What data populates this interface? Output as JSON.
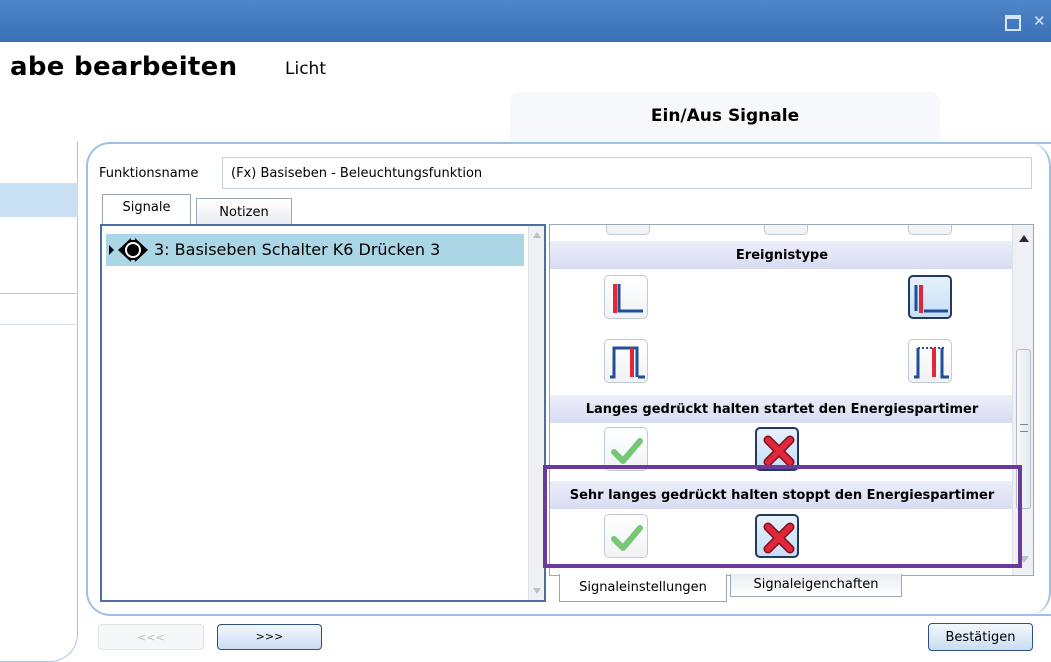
{
  "window": {
    "maximize_icon": "maximize-icon",
    "close_icon": "close-icon",
    "close_glyph": "✕"
  },
  "header": {
    "title": "abe bearbeiten",
    "subtitle": "Licht",
    "tab_title": "Ein/Aus Signale"
  },
  "function": {
    "name_label": "Funktionsname",
    "name_value": "(Fx) Basiseben - Beleuchtungsfunktion"
  },
  "tabs": {
    "signale": "Signale",
    "notizen": "Notizen"
  },
  "signal_list": {
    "items": [
      {
        "label": "3: Basiseben Schalter K6 Drücken 3"
      }
    ]
  },
  "settings": {
    "sections": [
      {
        "title": "Ereignistype"
      },
      {
        "title": "Langes gedrückt halten startet den Energiespartimer"
      },
      {
        "title": "Sehr langes gedrückt halten stoppt den Energiespartimer"
      }
    ],
    "bottom_tabs": {
      "settings": "Signaleinstellungen",
      "properties": "Signaleigenchaften"
    },
    "colors": {
      "accent_purple": "#6b3a9c",
      "edge_red": "#e0283a",
      "edge_blue": "#1f4f9a",
      "check_green": "#76c776"
    }
  },
  "buttons": {
    "prev": "<<<",
    "next": ">>>",
    "confirm": "Bestätigen"
  }
}
